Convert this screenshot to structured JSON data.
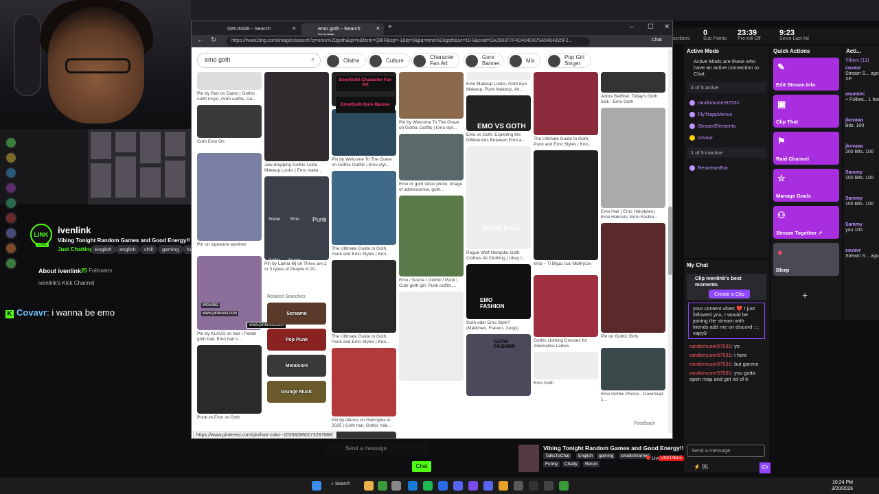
{
  "browser": {
    "tabs": [
      {
        "label": "GRUNGE - Search"
      },
      {
        "label": "emo goth - Search Images"
      }
    ],
    "url": "https://www.bing.com/images/search?q=emo%20goth&qs=n&form=QBIR&sp=-1&lq=0&pq=emo%20goth&sc=10-8&cvid=DA290377F4D404D875A6484825F2...",
    "chat_label": "Chat",
    "search_value": "emo goth",
    "chips": [
      {
        "label": "Olathe"
      },
      {
        "label": "Culture"
      },
      {
        "label": "Character Fan Art"
      },
      {
        "label": "Gore Banner"
      },
      {
        "label": "Mix"
      },
      {
        "label": "Pop Girl Singer"
      }
    ],
    "columns": [
      [
        {
          "cap": "Pin by Ran on Darko | Gothic outfit inspo, Goth outfits, Da...",
          "h": 26,
          "c": "#ddd"
        },
        {
          "cap": "Goth Emo On",
          "h": 48,
          "c": "#3a3a3a"
        },
        {
          "cap": "Pin on signature eyeliner",
          "h": 128,
          "c": "#7b7fa3"
        },
        {
          "cap": "Pin by KLAUS on hair | Pastel goth hair, Emo hair c...",
          "h": 108,
          "c": "#8b6f9a"
        },
        {
          "cap": "Punk vs Emo vs Goth",
          "h": 100,
          "c": "#2a2a2a"
        }
      ],
      [
        {
          "cap": "Jaw-dropping Gothic Lolita Makeup Looks | Emo make...",
          "h": 130,
          "c": "#2f2b2f"
        },
        {
          "cap": "Pin by Lamia Mj on There are 2 or 3 types of People in 20...",
          "h": 122,
          "c": "#3a3f4a"
        }
      ],
      [
        {
          "cap": "",
          "h": 50,
          "c": "#222"
        },
        {
          "cap": "Pin by Welcome To The Grave on Gothic Outfits | Emo styl...",
          "h": 68,
          "c": "#2d4b5e"
        },
        {
          "cap": "The Ultimate Guide to Goth, Punk and Emo Styles | Kno...",
          "h": 108,
          "c": "#3e6a88"
        },
        {
          "cap": "The Ultimate Guide to Goth, Punk and Emo Styles | Kno...",
          "h": 106,
          "c": "#2a2a2a"
        },
        {
          "cap": "Pin by Ailurus on Hairstyles in 2025 | Goth hair, Gothic hair...",
          "h": 100,
          "c": "#b33a3a"
        },
        {
          "cap": "The Ultimate Guide to Goth, Punk and Emo Styles | Kno...",
          "h": 30,
          "c": "#333"
        }
      ],
      [
        {
          "cap": "Pin by Welcome To The Grave on Gothic Outfits | Emo styl...",
          "h": 68,
          "c": "#8a6a4a"
        },
        {
          "cap": "Emo or goth stock photo. Image of adolescence, goth...",
          "h": 68,
          "c": "#5a6a6a"
        },
        {
          "cap": "Emo / Scene / Gothic / Punk | Cute goth girl, Punk outfits,...",
          "h": 118,
          "c": "#5a7a4a"
        },
        {
          "cap": "",
          "h": 130,
          "c": "#ececec"
        }
      ],
      [
        {
          "cap": "Emo Makeup Looks, Goth Eye Makeup, Punk Makeup, Alt...",
          "h": 12,
          "c": "#eee"
        },
        {
          "cap": "Emo vs Goth: Exploring the Differences Between Emo a...",
          "h": 52,
          "c": "#222"
        },
        {
          "cap": "Rogue Wolf Harajuku Goth Clothes Alt Clothing | Ubuy I...",
          "h": 150,
          "c": "#eee"
        },
        {
          "cap": "Goth oder Emo Style? (Mädchen, Frauen, Jungs)",
          "h": 80,
          "c": "#111"
        },
        {
          "cap": "",
          "h": 90,
          "c": "#4a4a5a"
        }
      ],
      [
        {
          "cap": "The Ultimate Guide to Goth, Punk and Emo Styles | Kno...",
          "h": 92,
          "c": "#8a2a3a"
        },
        {
          "cap": "emo – Τι Βήμα των Μαθητών",
          "h": 160,
          "c": "#1f1f1f"
        },
        {
          "cap": "Gothic clothing Dresses for Alternative Ladies",
          "h": 90,
          "c": "#a03040"
        },
        {
          "cap": "Emo Goth",
          "h": 40,
          "c": "#eee"
        }
      ],
      [
        {
          "cap": "Adora BatBrat: Today's Goth look - Emo Goth",
          "h": 30,
          "c": "#333"
        },
        {
          "cap": "Emo Hair | Emo Hairstyles | Emo Haircuts: Emo Fashio...",
          "h": 146,
          "c": "#aaa"
        },
        {
          "cap": "Pin on Gothic Girls",
          "h": 160,
          "c": "#5a2a2a"
        },
        {
          "cap": "Emo Gothic Photos - Download 1...",
          "h": 62,
          "c": "#3a4a4a"
        }
      ]
    ],
    "related_title": "Related Searches",
    "related": [
      {
        "label": "Screamo",
        "c": "#5a3a2a"
      },
      {
        "label": "Pop Punk",
        "c": "#8a2222"
      },
      {
        "label": "Metalcore",
        "c": "#3a3a3a"
      },
      {
        "label": "Grunge Music",
        "c": "#6a5a2a"
      }
    ],
    "overlays": {
      "size": "842x982",
      "source": "www.pinterest.com",
      "dim": "www.pinterest.com"
    },
    "status_url": "https://www.pinterest.com/pin/hair-color--1035828601732876​88/",
    "feedback": "Feedback",
    "image_texts": {
      "char_art": "Emo/Goth Character Fan Art",
      "gore": "Emo/Goth Gore Banner",
      "scene": "Scene",
      "emo": "Emo",
      "punk": "Punk",
      "gothic": "Gothic",
      "grunge": "Grunge",
      "metalhead": "Metalhead",
      "emo_vs_goth": "EMO VS GOTH",
      "emo_fashion": "EMO FASHION",
      "goth_fashion": "GOTH FASHION",
      "moon_doll": "MOON DOLL",
      "emo_small": "Emo"
    }
  },
  "stream": {
    "channel_name": "ivenlink",
    "title": "Vibing Tonight Random Games and Good Energy!!",
    "category": "Just Chatting",
    "tags": [
      "English",
      "english",
      "chill",
      "gaming",
      "fun"
    ],
    "logo": "LINK",
    "live": "LIVE",
    "about": "About ivenlink",
    "followers_count": "25",
    "followers_label": "Followers",
    "kick_channel": "ivenlink's Kick Channel",
    "chat_user": "Covavr",
    "chat_message": "i wanna be emo",
    "send_placeholder": "Send a message",
    "chat_button": "Chat"
  },
  "dashboard": {
    "stats": [
      {
        "value": "0",
        "label": "Sub Points"
      },
      {
        "value": "23:39",
        "label": "Pre-roll Off"
      },
      {
        "value": "9:23",
        "label": "Since Last Ad"
      }
    ],
    "subscribers_label": "scribers",
    "active_mods": {
      "title": "Active Mods",
      "description": "Active Mods are those who have an active connection to Chat.",
      "active_count": "4 of 5 active",
      "active": [
        "randomuser97531",
        "FlyTrappVenus",
        "StreamElements",
        "covavr"
      ],
      "inactive_count": "1 of 5 inactive",
      "inactive": [
        "RestreamBot"
      ]
    },
    "quick_actions": {
      "title": "Quick Actions",
      "items": [
        {
          "label": "Edit Stream Info",
          "icon": "pencil-icon"
        },
        {
          "label": "Clip That",
          "icon": "clip-icon"
        },
        {
          "label": "Raid Channel",
          "icon": "raid-icon"
        },
        {
          "label": "Manage Goals",
          "icon": "star-icon"
        },
        {
          "label": "Stream Together ↗",
          "icon": "add-user-icon"
        },
        {
          "label": "Blerp",
          "icon": "blerp-icon"
        }
      ],
      "add": "+"
    },
    "activity": {
      "title": "Acti...",
      "filters": "Filters (13)",
      "items": [
        {
          "user": "covavr",
          "text": "Stream S... ago",
          "extra": "XP"
        },
        {
          "user": "anomiec",
          "text": "+ Follow... 1 hours ag",
          "extra": ""
        },
        {
          "user": "jkovaaa",
          "text": "Bits. 100",
          "extra": ""
        },
        {
          "user": "jkovaaa",
          "text": "200 Bits. 100",
          "extra": ""
        },
        {
          "user": "Sammy",
          "text": "100 Bits. 100",
          "extra": ""
        },
        {
          "user": "Sammy",
          "text": "100 Bits. 100",
          "extra": ""
        },
        {
          "user": "Sammy",
          "text": "you 100",
          "extra": ""
        },
        {
          "user": "covavr",
          "text": "Stream S... ago",
          "extra": ""
        }
      ]
    },
    "my_chat": {
      "title": "My Chat",
      "clip_text": "Clip ivenlink's best moments",
      "clip_button": "Create a Clip",
      "highlight": "your content vibes ❤️ I just followed you, I would be joining the stream with friends add me on discord :::: vapy9",
      "messages": [
        {
          "user": "randomuser97531",
          "text": "yo"
        },
        {
          "user": "randomuser97531",
          "text": "i here"
        },
        {
          "user": "randomuser97531",
          "text": "but ganme"
        },
        {
          "user": "randomuser97531",
          "text": "you gotta open map and get rid of it"
        }
      ],
      "input_placeholder": "Send a message",
      "viewers": "95",
      "chat_short": "Ch"
    },
    "stream_card": {
      "title": "Vibing Tonight Random Games and Good Energy!!",
      "tags": [
        "TalksToChat",
        "English",
        "gaming",
        "smallstreamer"
      ],
      "tags2": [
        "Funny",
        "Chatty",
        "Rerun"
      ],
      "live": "Live",
      "unstable": "UNSTABLE"
    }
  },
  "taskbar": {
    "search": "Search",
    "time": "10:24 PM",
    "date": "3/20/2026"
  }
}
